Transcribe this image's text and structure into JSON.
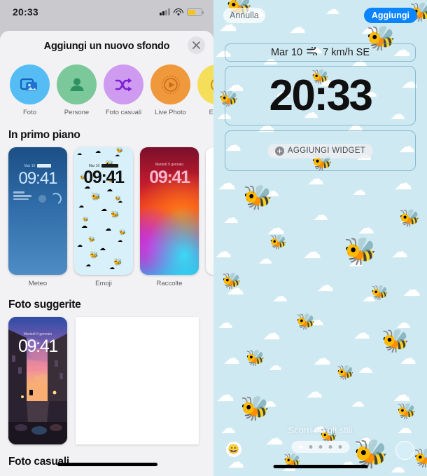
{
  "left_panel": {
    "status_bar": {
      "time": "20:33",
      "signal_icon": "cellular-signal-icon",
      "wifi_icon": "wifi-icon",
      "battery_icon": "battery-low-power-icon",
      "battery_level": 55
    },
    "sheet": {
      "title": "Aggiungi un nuovo sfondo",
      "close_icon": "close-icon",
      "categories": [
        {
          "label": "Foto",
          "icon": "photos-icon",
          "color": "#56bdf4"
        },
        {
          "label": "Persone",
          "icon": "person-icon",
          "color": "#7bc89a"
        },
        {
          "label": "Foto casuali",
          "icon": "shuffle-icon",
          "color": "#cf9bf0"
        },
        {
          "label": "Live Photo",
          "icon": "live-photo-icon",
          "color": "#f0983c"
        },
        {
          "label": "Emoji",
          "icon": "emoji-icon",
          "color": "#f5de5a"
        }
      ],
      "sections": [
        {
          "title": "In primo piano"
        },
        {
          "title": "Foto suggerite"
        },
        {
          "title": "Foto casuali"
        }
      ],
      "featured": [
        {
          "name": "Meteo",
          "date": "Mar 10",
          "time": "09:41"
        },
        {
          "name": "Emoji",
          "date": "Mar 10",
          "time": "09:41"
        },
        {
          "name": "Raccolte",
          "date": "Martedì 9 gennaio",
          "time": "09:41"
        },
        {
          "name": "",
          "date": "",
          "time": ""
        }
      ],
      "suggested": [
        {
          "name": "",
          "date": "Martedì 9 gennaio",
          "time": "09:41"
        }
      ]
    }
  },
  "right_panel": {
    "cancel_label": "Annulla",
    "add_label": "Aggiungi",
    "weather_widget": {
      "date": "Mar 10",
      "wind_icon": "wind-icon",
      "wind": "7 km/h SE"
    },
    "clock": "20:33",
    "add_widget": {
      "label": "AGGIUNGI WIDGET",
      "icon": "plus-circle-icon"
    },
    "styles_hint": "Scorri tra gli stili",
    "page_dots": {
      "count": 5,
      "active_index": 0
    },
    "bottom_left_icon": "emoji-smiley-icon",
    "bottom_right_icon": "camera-circle-icon",
    "wallpaper": {
      "theme": "bee-clouds",
      "sky_color": "#cfe9f2",
      "bee_glyph": "🐝"
    }
  }
}
